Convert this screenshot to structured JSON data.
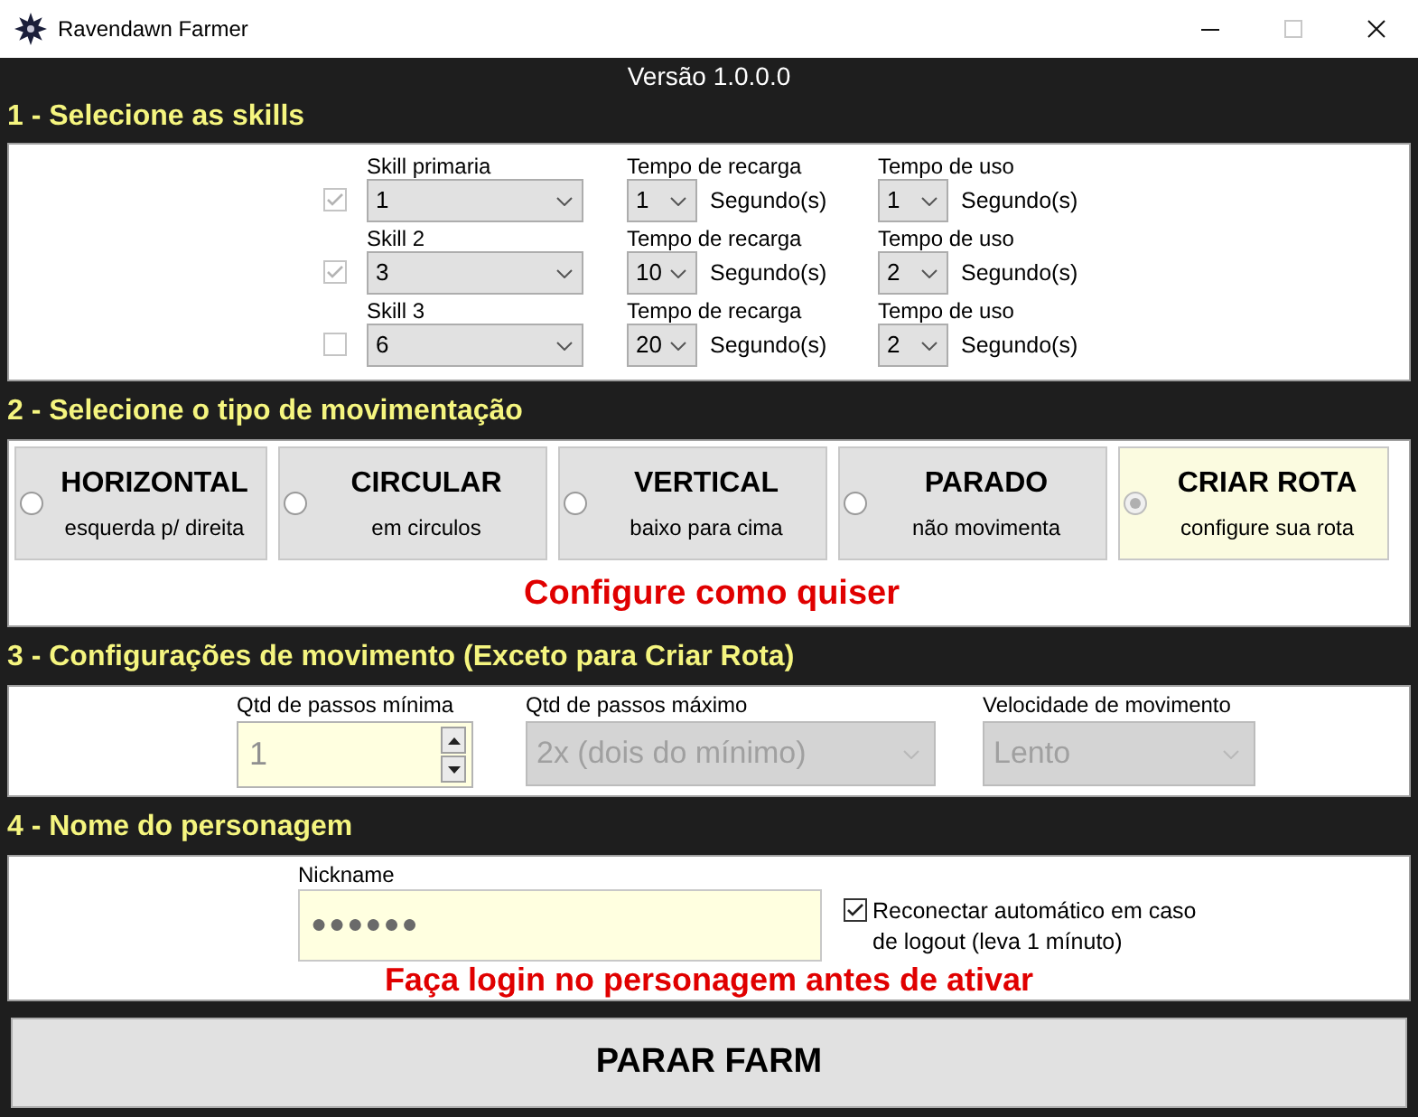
{
  "window": {
    "title": "Ravendawn Farmer",
    "maximize_disabled": true
  },
  "version": "Versão 1.0.0.0",
  "skills": {
    "heading": "1 - Selecione as skills",
    "rows": [
      {
        "checked": true,
        "disabled": true,
        "skill": {
          "label": "Skill primaria",
          "value": "1"
        },
        "cooldown": {
          "label": "Tempo de recarga",
          "value": "1",
          "unit": "Segundo(s)"
        },
        "duration": {
          "label": "Tempo de uso",
          "value": "1",
          "unit": "Segundo(s)"
        }
      },
      {
        "checked": true,
        "disabled": true,
        "skill": {
          "label": "Skill 2",
          "value": "3"
        },
        "cooldown": {
          "label": "Tempo de recarga",
          "value": "10",
          "unit": "Segundo(s)"
        },
        "duration": {
          "label": "Tempo de uso",
          "value": "2",
          "unit": "Segundo(s)"
        }
      },
      {
        "checked": false,
        "disabled": true,
        "skill": {
          "label": "Skill 3",
          "value": "6"
        },
        "cooldown": {
          "label": "Tempo de recarga",
          "value": "20",
          "unit": "Segundo(s)"
        },
        "duration": {
          "label": "Tempo de uso",
          "value": "2",
          "unit": "Segundo(s)"
        }
      }
    ]
  },
  "movement": {
    "heading": "2 - Selecione o tipo de movimentação",
    "options": [
      {
        "title": "HORIZONTAL",
        "subtitle": "esquerda p/ direita",
        "selected": false
      },
      {
        "title": "CIRCULAR",
        "subtitle": "em circulos",
        "selected": false
      },
      {
        "title": "VERTICAL",
        "subtitle": "baixo para cima",
        "selected": false
      },
      {
        "title": "PARADO",
        "subtitle": "não movimenta",
        "selected": false
      },
      {
        "title": "CRIAR ROTA",
        "subtitle": "configure sua rota",
        "selected": true
      }
    ],
    "note": "Configure como quiser"
  },
  "movement_settings": {
    "heading": "3 - Configurações de movimento (Exceto para Criar Rota)",
    "min_steps": {
      "label": "Qtd de passos mínima",
      "value": "1"
    },
    "max_steps": {
      "label": "Qtd de passos máximo",
      "value": "2x (dois do mínimo)",
      "disabled": true
    },
    "speed": {
      "label": "Velocidade de movimento",
      "value": "Lento",
      "disabled": true
    }
  },
  "character": {
    "heading": "4 - Nome do personagem",
    "nickname": {
      "label": "Nickname",
      "value": "●●●●●●"
    },
    "reconnect": {
      "label": "Reconectar automático em caso de logout (leva 1 mínuto)",
      "checked": true
    },
    "note": "Faça login no personagem antes de ativar"
  },
  "action_button": "PARAR FARM"
}
